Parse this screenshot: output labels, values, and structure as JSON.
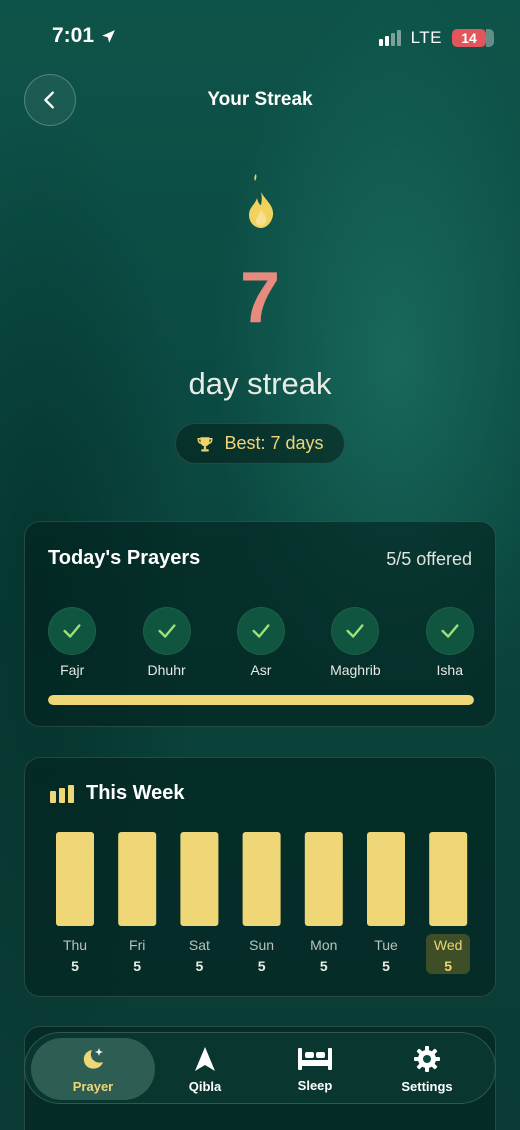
{
  "status_bar": {
    "time": "7:01",
    "network": "LTE",
    "battery": "14"
  },
  "header": {
    "title": "Your Streak"
  },
  "streak": {
    "count": "7",
    "label": "day streak",
    "best": "Best: 7 days"
  },
  "today": {
    "title": "Today's Prayers",
    "summary": "5/5 offered",
    "progress": 1.0,
    "prayers": [
      {
        "name": "Fajr",
        "done": true
      },
      {
        "name": "Dhuhr",
        "done": true
      },
      {
        "name": "Asr",
        "done": true
      },
      {
        "name": "Maghrib",
        "done": true
      },
      {
        "name": "Isha",
        "done": true
      }
    ]
  },
  "week": {
    "title": "This Week",
    "days": [
      {
        "day": "Thu",
        "count": "5",
        "value": 5
      },
      {
        "day": "Fri",
        "count": "5",
        "value": 5
      },
      {
        "day": "Sat",
        "count": "5",
        "value": 5
      },
      {
        "day": "Sun",
        "count": "5",
        "value": 5
      },
      {
        "day": "Mon",
        "count": "5",
        "value": 5
      },
      {
        "day": "Tue",
        "count": "5",
        "value": 5
      },
      {
        "day": "Wed",
        "count": "5",
        "value": 5,
        "current": true
      }
    ],
    "max": 5
  },
  "tabbar": {
    "tabs": [
      {
        "label": "Prayer",
        "icon": "moon-stars-icon",
        "active": true
      },
      {
        "label": "Qibla",
        "icon": "navigation-arrow-icon",
        "active": false
      },
      {
        "label": "Sleep",
        "icon": "bed-icon",
        "active": false
      },
      {
        "label": "Settings",
        "icon": "gear-icon",
        "active": false
      }
    ]
  },
  "colors": {
    "accent": "#efd676",
    "streak": "#e98a7f",
    "check": "#9fe07a"
  }
}
